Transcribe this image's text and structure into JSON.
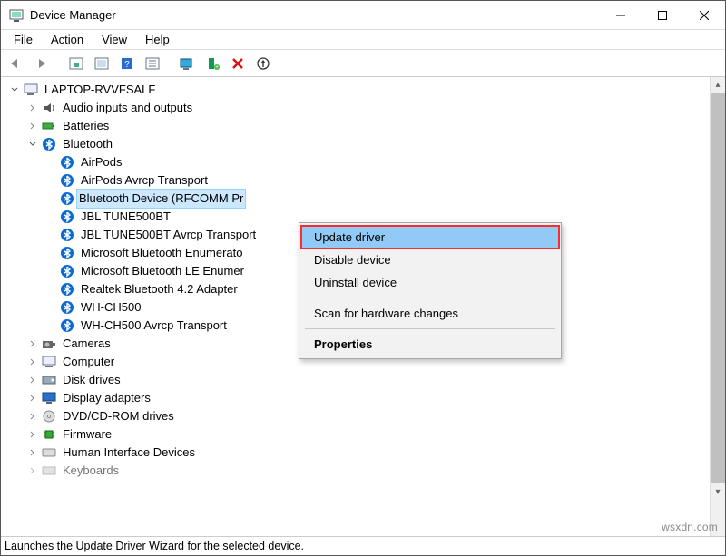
{
  "window": {
    "title": "Device Manager"
  },
  "menu": {
    "file": "File",
    "action": "Action",
    "view": "View",
    "help": "Help"
  },
  "tree": {
    "root": "LAPTOP-RVVFSALF",
    "audio": "Audio inputs and outputs",
    "batteries": "Batteries",
    "bluetooth": "Bluetooth",
    "bt_items": {
      "0": "AirPods",
      "1": "AirPods Avrcp Transport",
      "2": "Bluetooth Device (RFCOMM Pr",
      "3": "JBL TUNE500BT",
      "4": "JBL TUNE500BT Avrcp Transport",
      "5": "Microsoft Bluetooth Enumerato",
      "6": "Microsoft Bluetooth LE Enumer",
      "7": "Realtek Bluetooth 4.2 Adapter",
      "8": "WH-CH500",
      "9": "WH-CH500 Avrcp Transport"
    },
    "cameras": "Cameras",
    "computer": "Computer",
    "disk": "Disk drives",
    "display": "Display adapters",
    "dvd": "DVD/CD-ROM drives",
    "firmware": "Firmware",
    "hid": "Human Interface Devices",
    "keyboards": "Keyboards"
  },
  "context": {
    "update": "Update driver",
    "disable": "Disable device",
    "uninstall": "Uninstall device",
    "scan": "Scan for hardware changes",
    "properties": "Properties"
  },
  "status": "Launches the Update Driver Wizard for the selected device.",
  "watermark": "wsxdn.com"
}
